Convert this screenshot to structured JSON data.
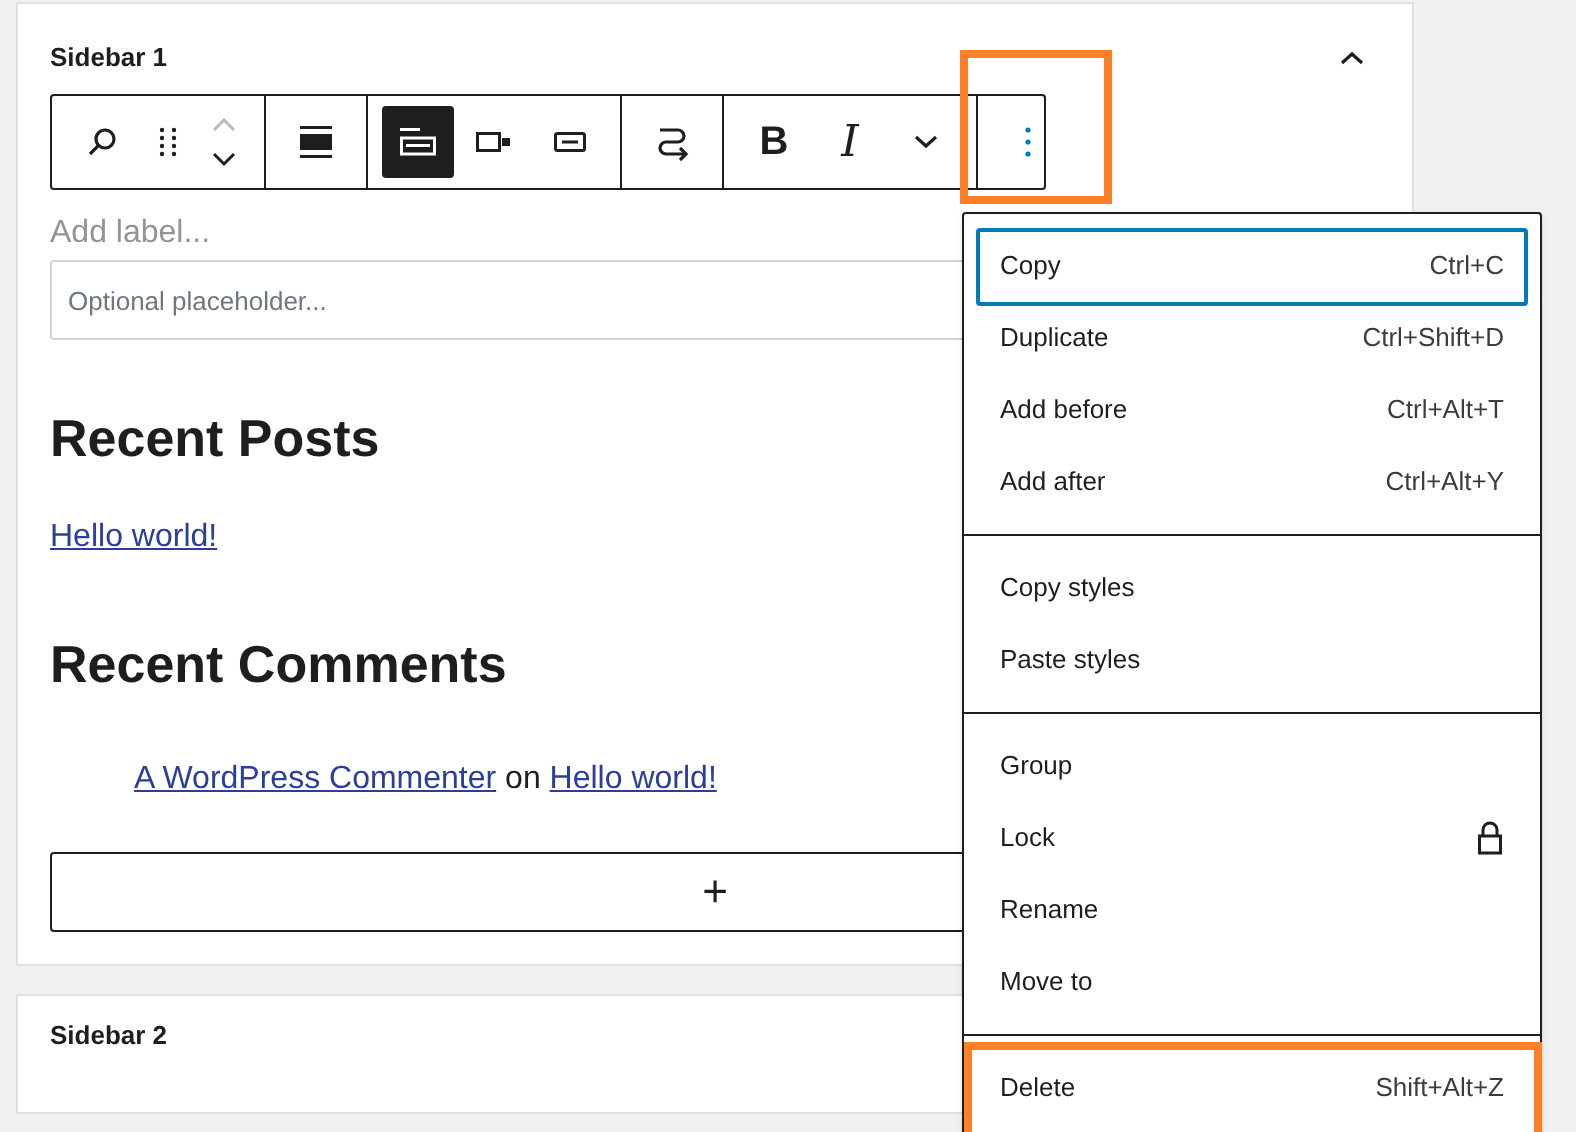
{
  "panel": {
    "title": "Sidebar 1",
    "expanded": true
  },
  "toolbar": {
    "groups": [
      {
        "buttons": [
          {
            "kind": "search",
            "selected": false
          },
          {
            "kind": "drag",
            "selected": false
          },
          {
            "kind": "movers",
            "selected": false
          }
        ]
      },
      {
        "buttons": [
          {
            "kind": "align-full",
            "selected": false
          }
        ]
      },
      {
        "buttons": [
          {
            "kind": "width-fill",
            "selected": true
          },
          {
            "kind": "width-fit",
            "selected": false
          },
          {
            "kind": "width-inline",
            "selected": false
          }
        ]
      },
      {
        "buttons": [
          {
            "kind": "transform",
            "selected": false
          }
        ]
      },
      {
        "buttons": [
          {
            "kind": "bold",
            "label": "B",
            "selected": false
          },
          {
            "kind": "italic",
            "label": "I",
            "selected": false
          },
          {
            "kind": "more-formats",
            "selected": false
          }
        ]
      },
      {
        "buttons": [
          {
            "kind": "options",
            "selected": true,
            "highlighted": true
          }
        ]
      }
    ]
  },
  "search_block": {
    "label_placeholder": "Add label...",
    "input_placeholder": "Optional placeholder..."
  },
  "recent_posts": {
    "heading": "Recent Posts",
    "links": [
      "Hello world!"
    ]
  },
  "recent_comments": {
    "heading": "Recent Comments",
    "items": [
      {
        "author": "A WordPress Commenter",
        "connector": "on",
        "post": "Hello world!"
      }
    ]
  },
  "appender": {
    "label": "+"
  },
  "second_panel": {
    "title": "Sidebar 2"
  },
  "menu": {
    "groups": [
      {
        "items": [
          {
            "kind": "shortcut",
            "label": "Copy",
            "shortcut": "Ctrl+C",
            "selected": true,
            "highlighted": false
          },
          {
            "kind": "shortcut",
            "label": "Duplicate",
            "shortcut": "Ctrl+Shift+D",
            "selected": false,
            "highlighted": false
          },
          {
            "kind": "shortcut",
            "label": "Add before",
            "shortcut": "Ctrl+Alt+T",
            "selected": false,
            "highlighted": false
          },
          {
            "kind": "shortcut",
            "label": "Add after",
            "shortcut": "Ctrl+Alt+Y",
            "selected": false,
            "highlighted": false
          }
        ]
      },
      {
        "items": [
          {
            "kind": "plain",
            "label": "Copy styles",
            "selected": false,
            "highlighted": false
          },
          {
            "kind": "plain",
            "label": "Paste styles",
            "selected": false,
            "highlighted": false
          }
        ]
      },
      {
        "items": [
          {
            "kind": "plain",
            "label": "Group",
            "selected": false,
            "highlighted": false
          },
          {
            "kind": "lock",
            "label": "Lock",
            "selected": false,
            "highlighted": false
          },
          {
            "kind": "plain",
            "label": "Rename",
            "selected": false,
            "highlighted": false
          },
          {
            "kind": "plain",
            "label": "Move to",
            "selected": false,
            "highlighted": false
          }
        ]
      },
      {
        "items": [
          {
            "kind": "shortcut",
            "label": "Delete",
            "shortcut": "Shift+Alt+Z",
            "selected": false,
            "highlighted": true
          }
        ]
      }
    ]
  }
}
